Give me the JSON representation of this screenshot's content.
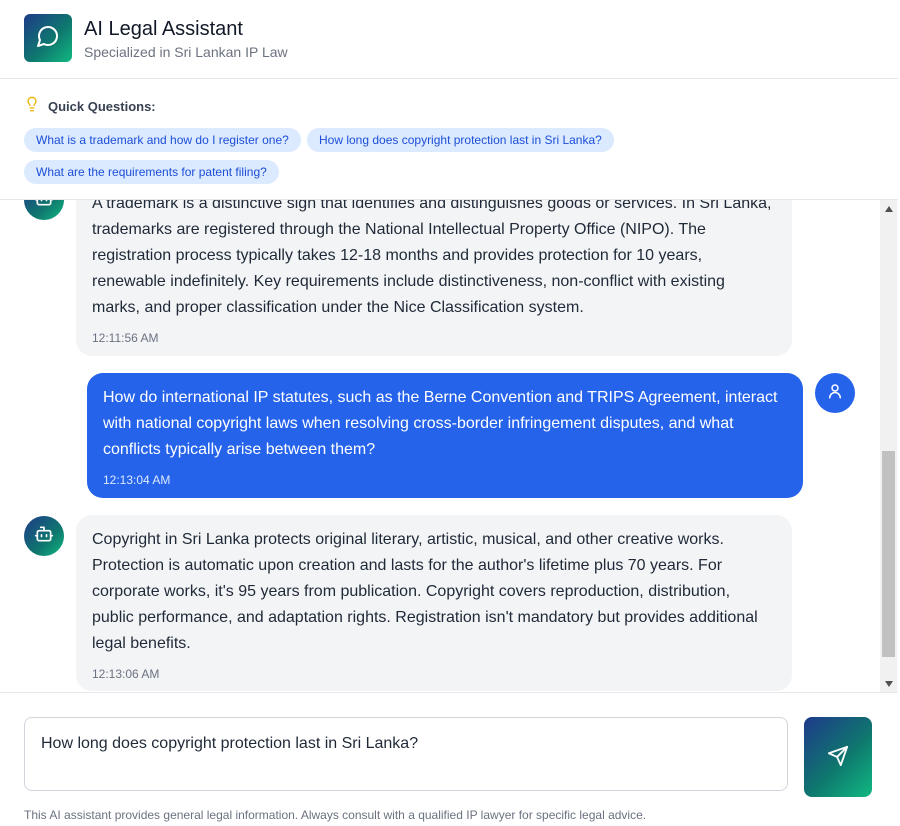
{
  "header": {
    "title": "AI Legal Assistant",
    "subtitle": "Specialized in Sri Lankan IP Law",
    "logo_icon": "chat-bubble-icon"
  },
  "quick_questions": {
    "title": "Quick Questions:",
    "icon": "lightbulb-icon",
    "items": [
      "What is a trademark and how do I register one?",
      "How long does copyright protection last in Sri Lanka?",
      "What are the requirements for patent filing?"
    ]
  },
  "messages": [
    {
      "role": "bot",
      "text": "A trademark is a distinctive sign that identifies and distinguishes goods or services. In Sri Lanka, trademarks are registered through the National Intellectual Property Office (NIPO). The registration process typically takes 12-18 months and provides protection for 10 years, renewable indefinitely. Key requirements include distinctiveness, non-conflict with existing marks, and proper classification under the Nice Classification system.",
      "time": "12:11:56 AM"
    },
    {
      "role": "user",
      "text": "How do international IP statutes, such as the Berne Convention and TRIPS Agreement, interact with national copyright laws when resolving cross-border infringement disputes, and what conflicts typically arise between them?",
      "time": "12:13:04 AM"
    },
    {
      "role": "bot",
      "text": "Copyright in Sri Lanka protects original literary, artistic, musical, and other creative works. Protection is automatic upon creation and lasts for the author's lifetime plus 70 years. For corporate works, it's 95 years from publication. Copyright covers reproduction, distribution, public performance, and adaptation rights. Registration isn't mandatory but provides additional legal benefits.",
      "time": "12:13:06 AM"
    }
  ],
  "composer": {
    "value": "How long does copyright protection last in Sri Lanka?",
    "send_icon": "send-icon",
    "disclaimer": "This AI assistant provides general legal information. Always consult with a qualified IP lawyer for specific legal advice."
  },
  "colors": {
    "accent": "#2563eb",
    "chip_bg": "#dbeafe",
    "bot_bubble": "#f3f4f6",
    "gradient_start": "#1e3a8a",
    "gradient_end": "#10b981"
  }
}
